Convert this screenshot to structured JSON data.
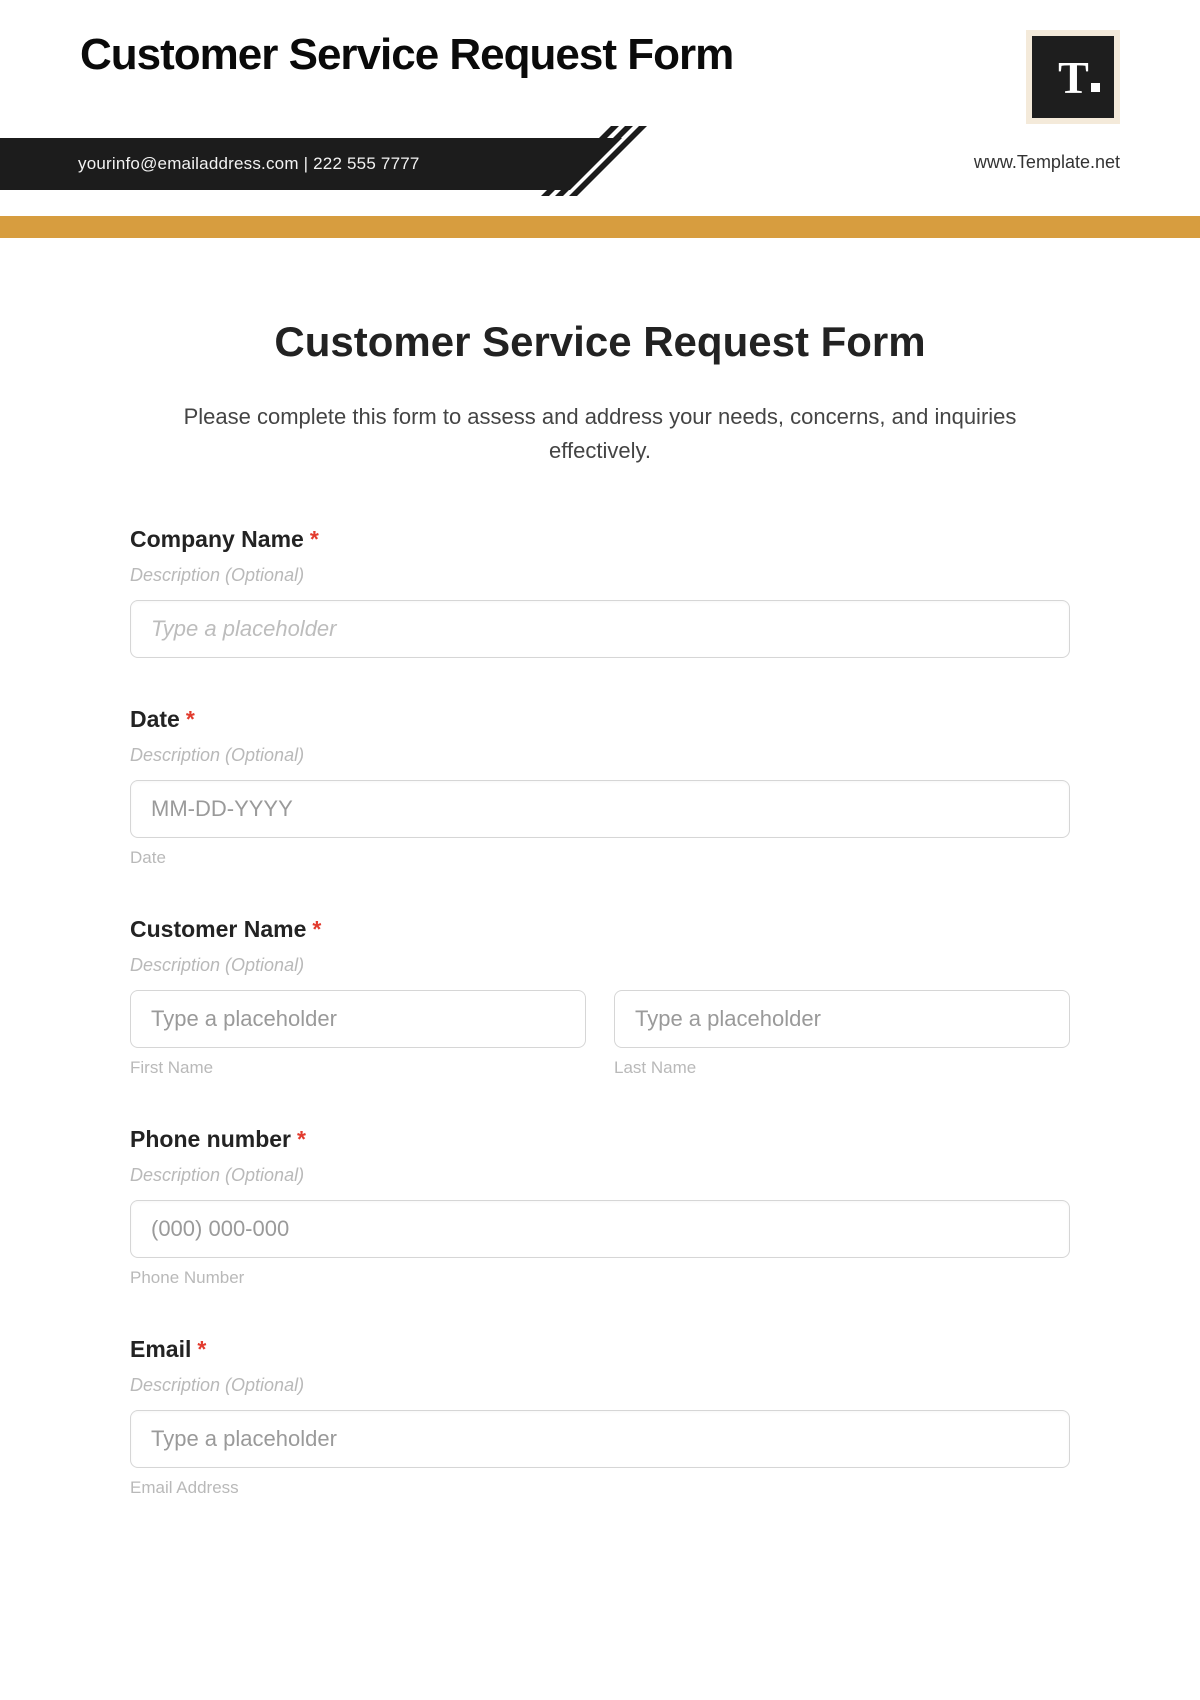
{
  "header": {
    "page_title": "Customer Service Request Form",
    "contact_line": "yourinfo@emailaddress.com  |  222 555 7777",
    "site_url": "www.Template.net",
    "brand_letter": "T"
  },
  "form": {
    "title": "Customer Service Request Form",
    "intro": "Please complete this form to assess and address your needs, concerns, and inquiries effectively.",
    "desc_optional": "Description (Optional)",
    "required_mark": "*",
    "company": {
      "label": "Company Name",
      "placeholder": "Type a placeholder"
    },
    "date": {
      "label": "Date",
      "placeholder": "MM-DD-YYYY",
      "sublabel": "Date"
    },
    "customer_name": {
      "label": "Customer Name",
      "first_placeholder": "Type a placeholder",
      "first_sublabel": "First Name",
      "last_placeholder": "Type a placeholder",
      "last_sublabel": "Last Name"
    },
    "phone": {
      "label": "Phone number",
      "placeholder": "(000) 000-000",
      "sublabel": "Phone Number"
    },
    "email": {
      "label": "Email",
      "placeholder": "Type a placeholder",
      "sublabel": "Email Address"
    }
  }
}
